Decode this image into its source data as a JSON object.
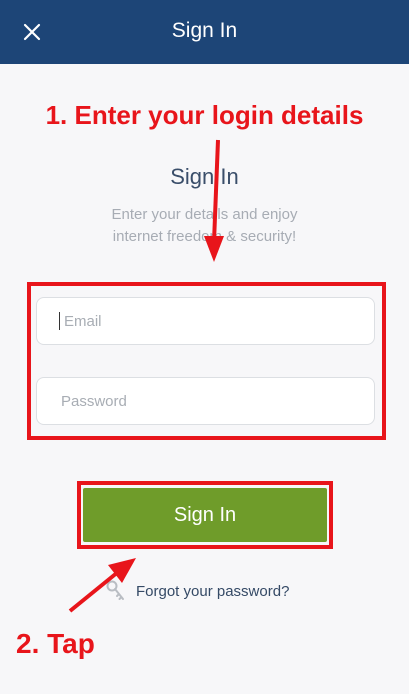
{
  "topbar": {
    "title": "Sign In",
    "close_icon": "close-icon"
  },
  "annotations": {
    "step1": "1. Enter your login details",
    "step2": "2. Tap"
  },
  "main": {
    "heading": "Sign In",
    "subtitle_line1": "Enter your details and enjoy",
    "subtitle_line2": "internet freedom & security!",
    "email_placeholder": "Email",
    "password_placeholder": "Password",
    "signin_label": "Sign In",
    "forgot_label": "Forgot your password?",
    "forgot_icon": "key-icon"
  },
  "colors": {
    "header": "#1d4577",
    "button": "#6f9c2a",
    "annotation": "#e8151b",
    "background": "#f7f7f9"
  }
}
